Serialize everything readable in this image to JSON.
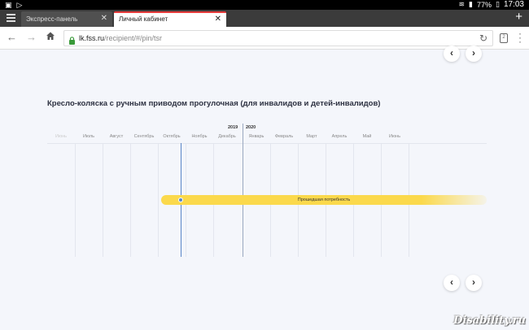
{
  "statusbar": {
    "battery": "77%",
    "time": "17:03"
  },
  "tabs": [
    {
      "label": "Экспресс-панель",
      "active": false
    },
    {
      "label": "Личный кабинет",
      "active": true
    }
  ],
  "toolbar": {
    "url_host": "lk.fss.ru",
    "url_path": "/recipient/#/pin/tsr",
    "tab_count": "2"
  },
  "page": {
    "title": "Кресло-коляска с ручным приводом прогулочная (для инвалидов и детей-инвалидов)",
    "years": [
      "2019",
      "2020"
    ],
    "months": [
      "Июнь",
      "Июль",
      "Август",
      "Сентябрь",
      "Октябрь",
      "Ноябрь",
      "Декабрь",
      "Январь",
      "Февраль",
      "Март",
      "Апрель",
      "Май",
      "Июнь"
    ],
    "need_label": "Прошедшая потребность"
  },
  "watermark": "Disability.ru",
  "colors": {
    "accent_blue": "#5a86c8",
    "need_yellow": "#fbd94c",
    "tab_active_border": "#e83c3c"
  }
}
